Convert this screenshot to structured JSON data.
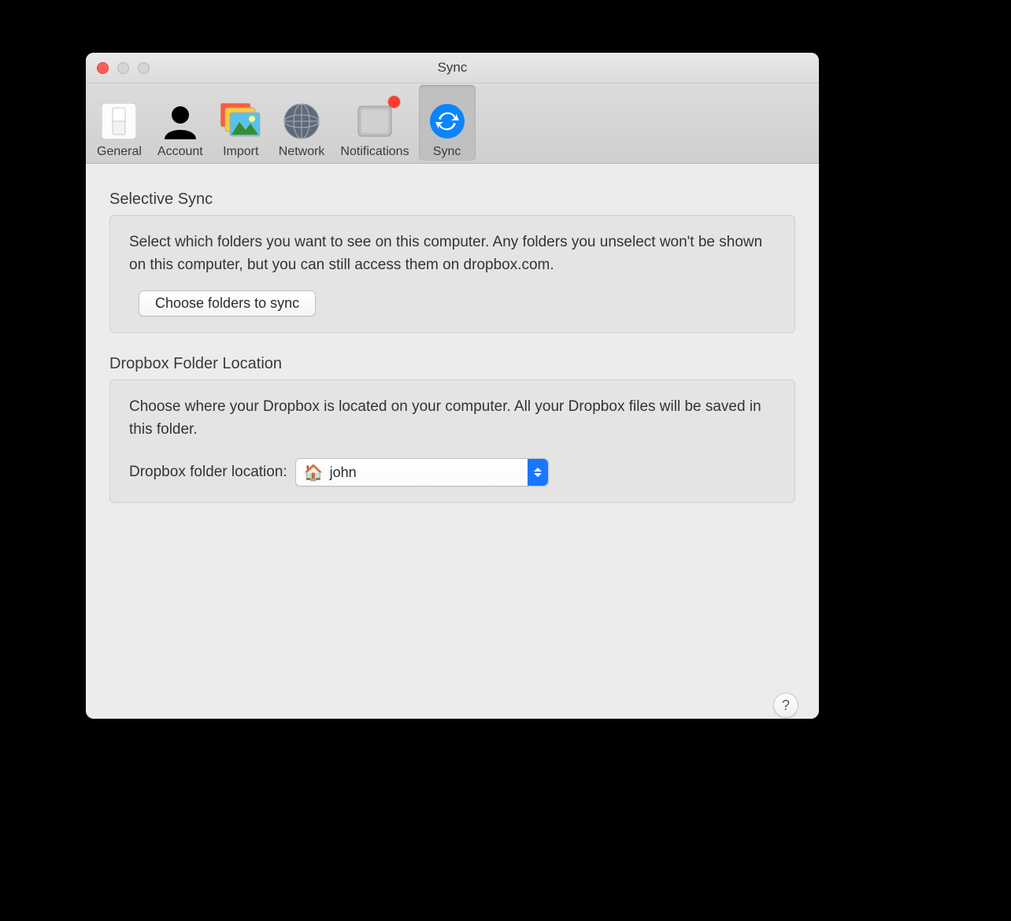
{
  "window": {
    "title": "Sync"
  },
  "toolbar": {
    "items": [
      {
        "label": "General"
      },
      {
        "label": "Account"
      },
      {
        "label": "Import"
      },
      {
        "label": "Network"
      },
      {
        "label": "Notifications"
      },
      {
        "label": "Sync"
      }
    ]
  },
  "selective_sync": {
    "title": "Selective Sync",
    "description": "Select which folders you want to see on this computer. Any folders you unselect won't be shown on this computer, but you can still access them on dropbox.com.",
    "button_label": "Choose folders to sync"
  },
  "folder_location": {
    "title": "Dropbox Folder Location",
    "description": "Choose where your Dropbox is located on your computer. All your Dropbox files will be saved in this folder.",
    "label": "Dropbox folder location:",
    "selected_value": "john"
  },
  "help": "?"
}
